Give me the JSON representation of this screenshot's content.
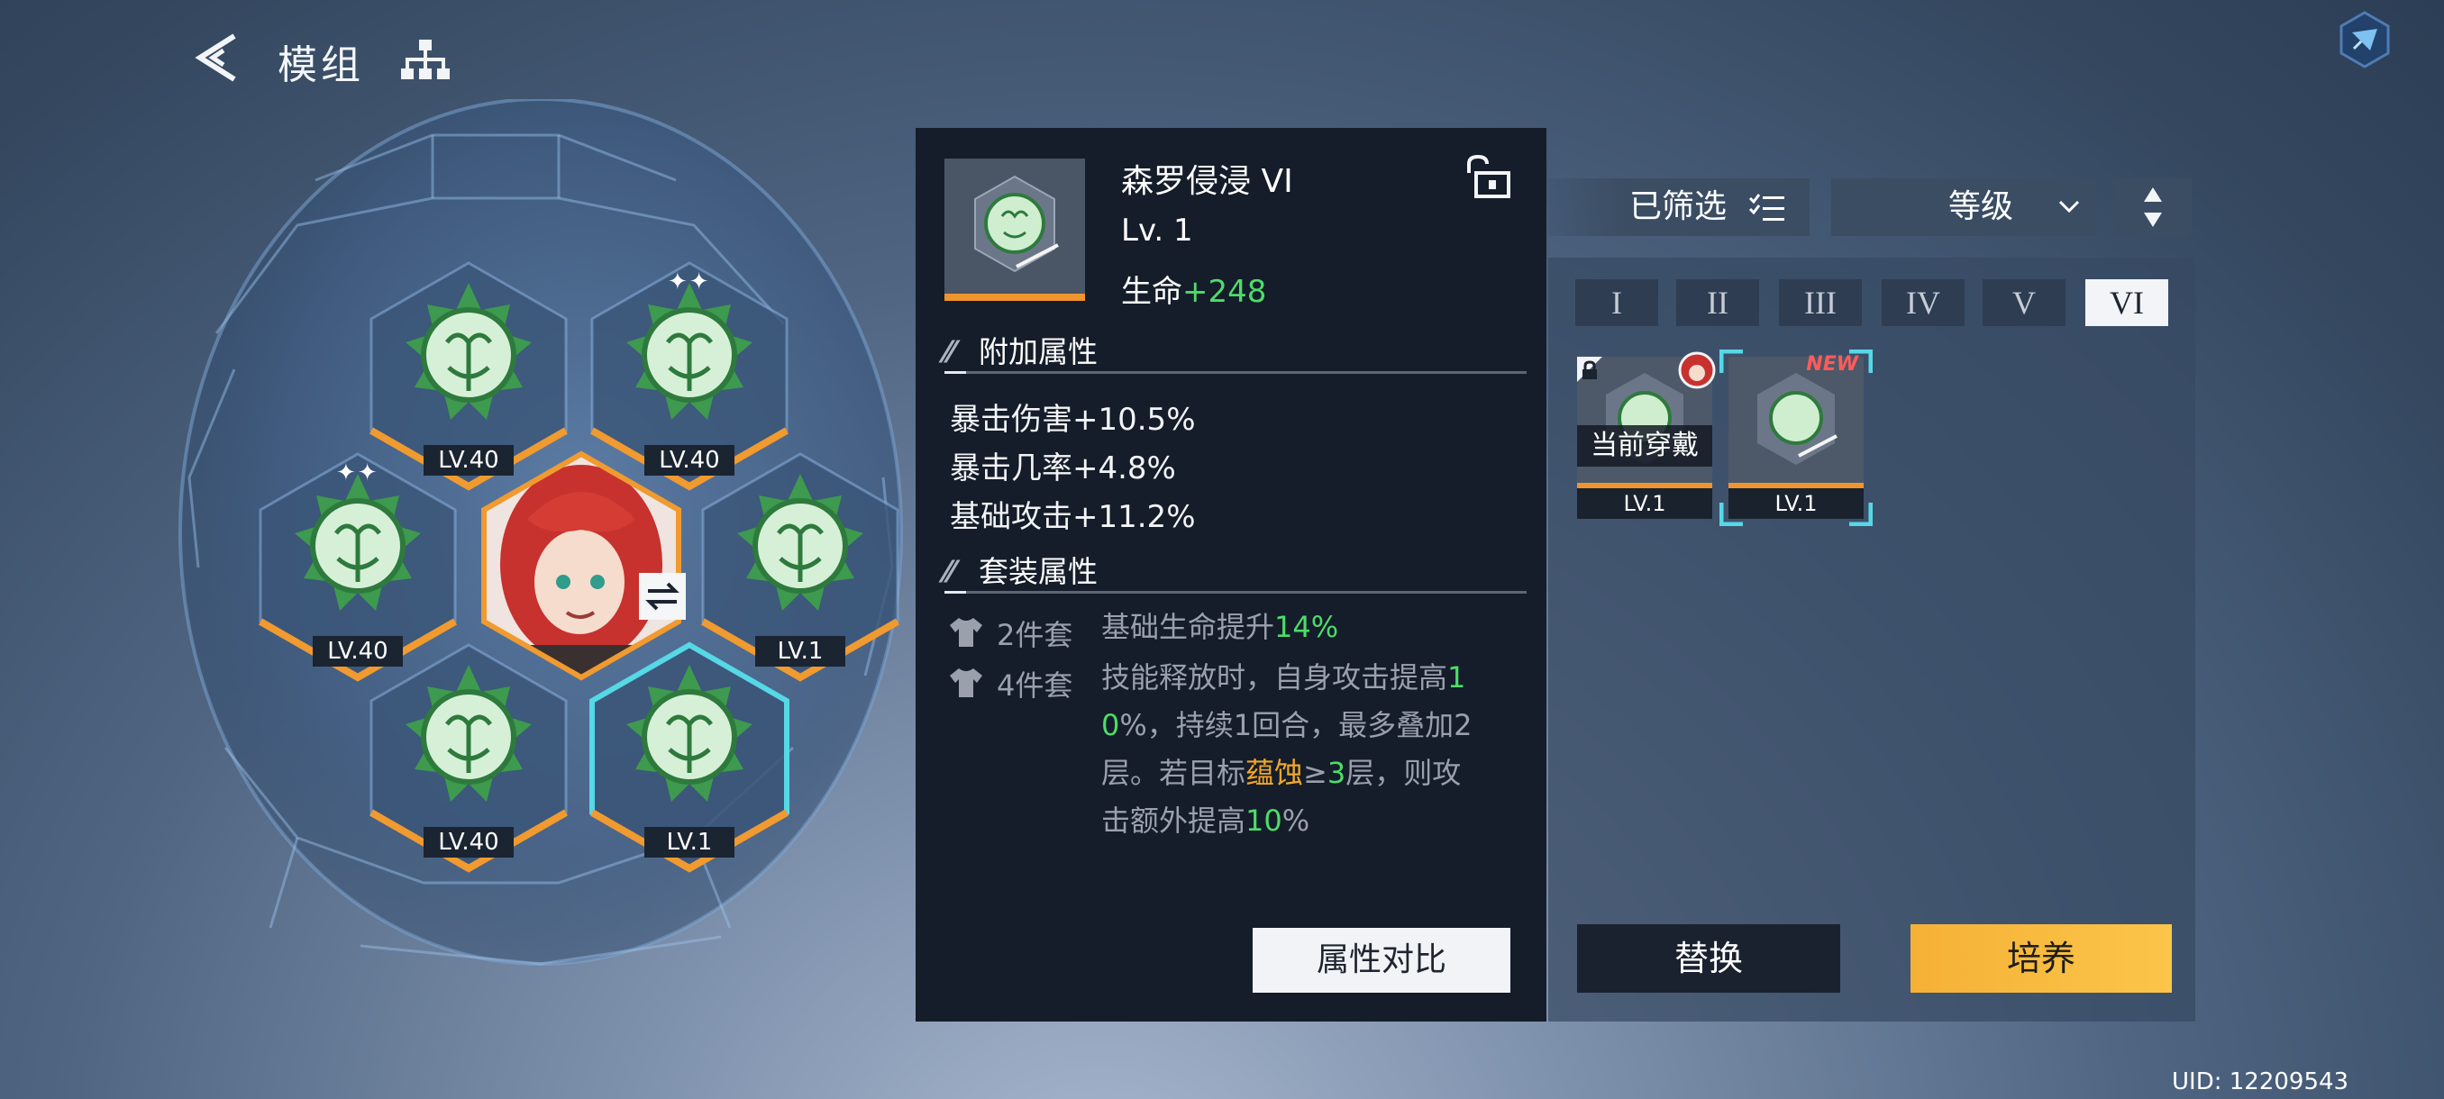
{
  "header": {
    "title": "模组"
  },
  "colors": {
    "accent_green": "#4ddc6a",
    "accent_orange": "#f0a62a",
    "module_bar": "#ef952e",
    "selected_cyan": "#56d8e6",
    "cultivate_yellow": "#f7bb3e"
  },
  "sockets": [
    {
      "level": "LV.40",
      "sparkles": ""
    },
    {
      "level": "LV.40",
      "sparkles": "✦✦"
    },
    {
      "level": "LV.40",
      "sparkles": "✦✦"
    },
    {
      "level": "LV.1",
      "sparkles": ""
    },
    {
      "level": "LV.40",
      "sparkles": ""
    },
    {
      "level": "LV.1",
      "sparkles": ""
    }
  ],
  "detail": {
    "name": "森罗侵浸 VI",
    "level": "Lv. 1",
    "main_stat_label": "生命",
    "main_stat_value": "+248",
    "sub_title": "附加属性",
    "sub_attrs": [
      "暴击伤害+10.5%",
      "暴击几率+4.8%",
      "基础攻击+11.2%"
    ],
    "set_title": "套装属性",
    "set2": {
      "count": "2件套",
      "desc_a": "基础生命提升",
      "desc_b": "14%"
    },
    "set4": {
      "count": "4件套",
      "line1a": "技能释放时，自身攻击提高",
      "line1b": "1",
      "line2a": "0",
      "line2b": "%，持续1回合，最多叠加2",
      "line3a": "层。若目标",
      "line3b": "蕴蚀",
      "line3c": "≥",
      "line3d": "3",
      "line3e": "层，则攻",
      "line4a": "击额外提高",
      "line4b": "10",
      "line4c": "%"
    },
    "compare_label": "属性对比"
  },
  "filter": {
    "filter_label": "已筛选",
    "sort_label": "等级"
  },
  "tier_tabs": [
    "I",
    "II",
    "III",
    "IV",
    "V",
    "VI"
  ],
  "inventory": [
    {
      "level": "LV.1",
      "status": "当前穿戴",
      "tag": ""
    },
    {
      "level": "LV.1",
      "status": "",
      "tag": "NEW"
    }
  ],
  "actions": {
    "replace_label": "替换",
    "cultivate_label": "培养"
  },
  "uid": "UID:  12209543"
}
